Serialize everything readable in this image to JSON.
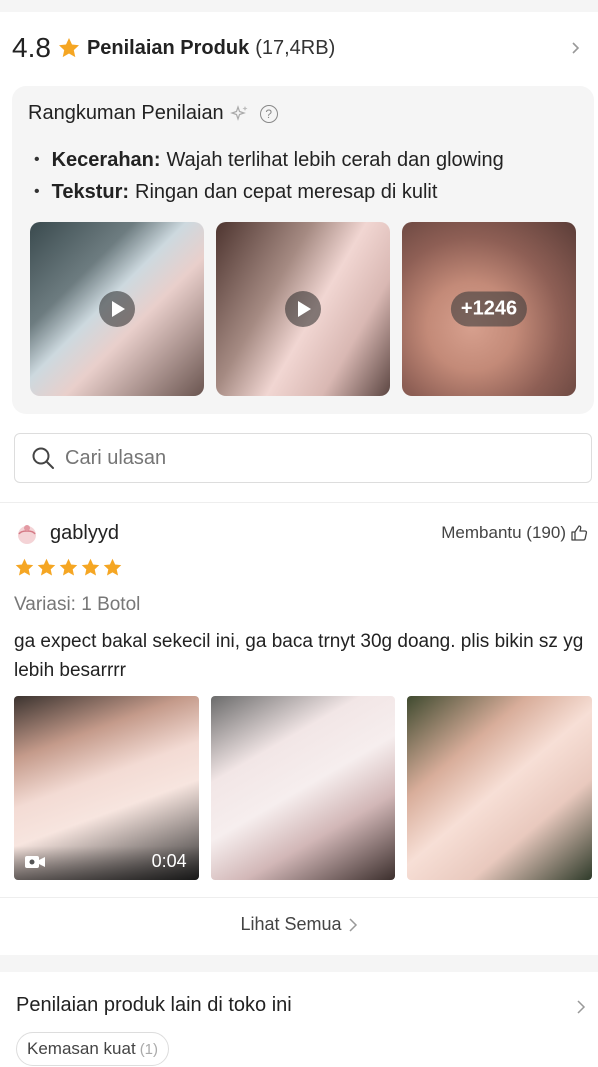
{
  "header": {
    "score": "4.8",
    "title": "Penilaian Produk",
    "count": "(17,4RB)",
    "star_color": "#f5a623"
  },
  "summary": {
    "title": "Rangkuman Penilaian",
    "items": [
      {
        "label": "Kecerahan:",
        "text": "Wajah terlihat lebih cerah dan glowing"
      },
      {
        "label": "Tekstur:",
        "text": "Ringan dan cepat meresap di kulit"
      }
    ],
    "more_media": "+1246"
  },
  "search": {
    "placeholder": "Cari ulasan"
  },
  "review": {
    "username": "gablyyd",
    "helpful": "Membantu (190)",
    "rating": 5,
    "variant": "Variasi: 1 Botol",
    "text": "ga expect bakal sekecil ini, ga baca trnyt 30g doang. plis bikin sz yg lebih besarrrr",
    "video_duration": "0:04"
  },
  "see_all": "Lihat Semua",
  "other": {
    "title": "Penilaian produk lain di toko ini",
    "tags": [
      {
        "label": "Kemasan kuat",
        "count": "(1)"
      }
    ]
  }
}
